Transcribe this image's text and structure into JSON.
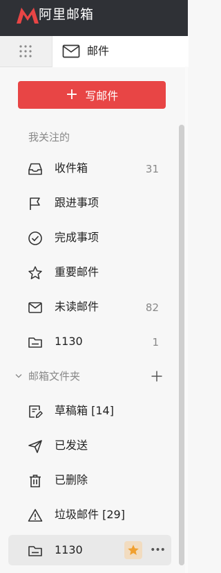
{
  "app": {
    "title": "阿里邮箱"
  },
  "tabs": {
    "mail_label": "邮件"
  },
  "compose": {
    "label": "写邮件"
  },
  "sidebar": {
    "section_title": "我关注的",
    "items": [
      {
        "label": "收件箱",
        "count": "31",
        "icon": "inbox-icon"
      },
      {
        "label": "跟进事项",
        "count": "",
        "icon": "flag-icon"
      },
      {
        "label": "完成事项",
        "count": "",
        "icon": "check-circle-icon"
      },
      {
        "label": "重要邮件",
        "count": "",
        "icon": "star-outline-icon"
      },
      {
        "label": "未读邮件",
        "count": "82",
        "icon": "envelope-icon"
      },
      {
        "label": "1130",
        "count": "1",
        "icon": "folder-icon"
      }
    ],
    "folders_title": "邮箱文件夹",
    "folders": [
      {
        "label": "草稿箱 [14]",
        "icon": "draft-icon"
      },
      {
        "label": "已发送",
        "icon": "send-icon"
      },
      {
        "label": "已删除",
        "icon": "trash-icon"
      },
      {
        "label": "垃圾邮件 [29]",
        "icon": "warning-icon"
      },
      {
        "label": "1130",
        "icon": "folder-icon"
      }
    ]
  },
  "colors": {
    "accent": "#e84545",
    "topbar": "#2f3136",
    "star": "#f0a030"
  }
}
